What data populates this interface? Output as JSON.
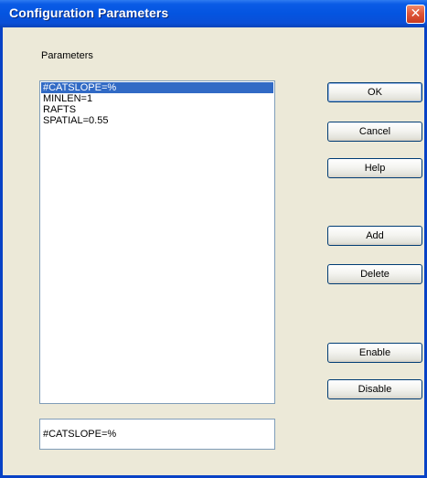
{
  "window": {
    "title": "Configuration Parameters",
    "close_glyph": "✕"
  },
  "parameters": {
    "label": "Parameters",
    "items": [
      {
        "text": "#CATSLOPE=%",
        "selected": true
      },
      {
        "text": "MINLEN=1",
        "selected": false
      },
      {
        "text": "RAFTS",
        "selected": false
      },
      {
        "text": "SPATIAL=0.55",
        "selected": false
      }
    ],
    "edit_value": "#CATSLOPE=%"
  },
  "buttons": {
    "ok": "OK",
    "cancel": "Cancel",
    "help": "Help",
    "add": "Add",
    "delete": "Delete",
    "enable": "Enable",
    "disable": "Disable"
  },
  "colors": {
    "titlebar": "#0454e0",
    "selection": "#316ac5",
    "dialog_bg": "#ece9d8"
  }
}
